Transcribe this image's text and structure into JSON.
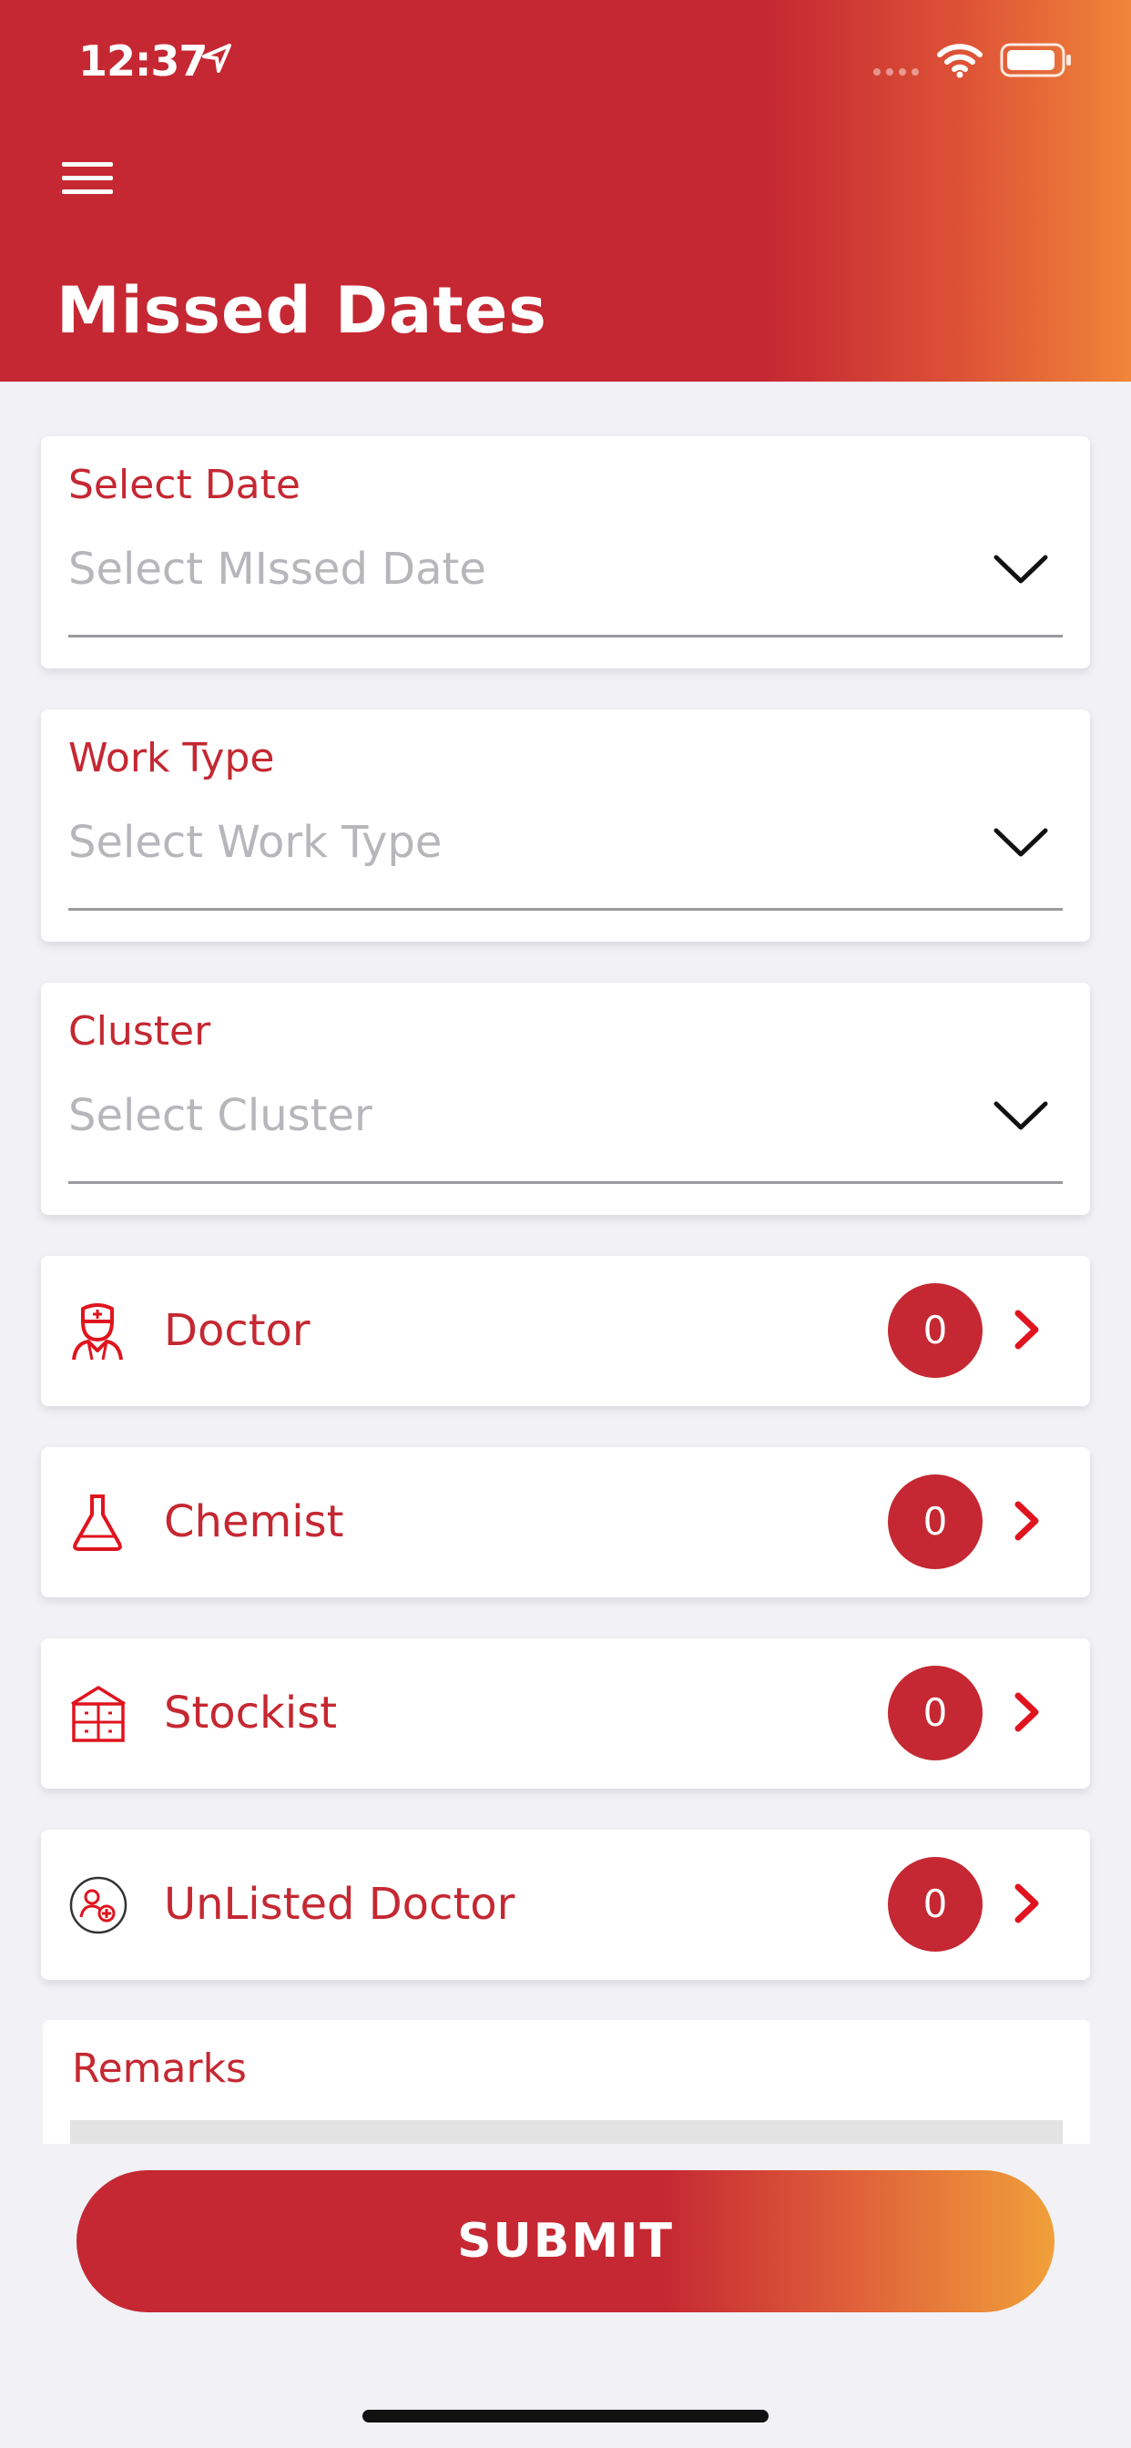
{
  "status_bar": {
    "time": "12:37"
  },
  "header": {
    "title": "Missed Dates"
  },
  "fields": [
    {
      "label": "Select Date",
      "placeholder": "Select MIssed Date"
    },
    {
      "label": "Work Type",
      "placeholder": "Select Work Type"
    },
    {
      "label": "Cluster",
      "placeholder": "Select Cluster"
    }
  ],
  "rows": [
    {
      "label": "Doctor",
      "count": "0",
      "icon": "doctor-icon"
    },
    {
      "label": "Chemist",
      "count": "0",
      "icon": "flask-icon"
    },
    {
      "label": "Stockist",
      "count": "0",
      "icon": "warehouse-icon"
    },
    {
      "label": "UnListed Doctor",
      "count": "0",
      "icon": "add-person-icon"
    }
  ],
  "remarks": {
    "label": "Remarks"
  },
  "submit": {
    "label": "SUBMIT"
  },
  "colors": {
    "accent": "#c52832",
    "gradient_end": "#f08539",
    "chevron": "#e0141e",
    "placeholder": "#b6b6bb",
    "background": "#f1f1f6"
  }
}
